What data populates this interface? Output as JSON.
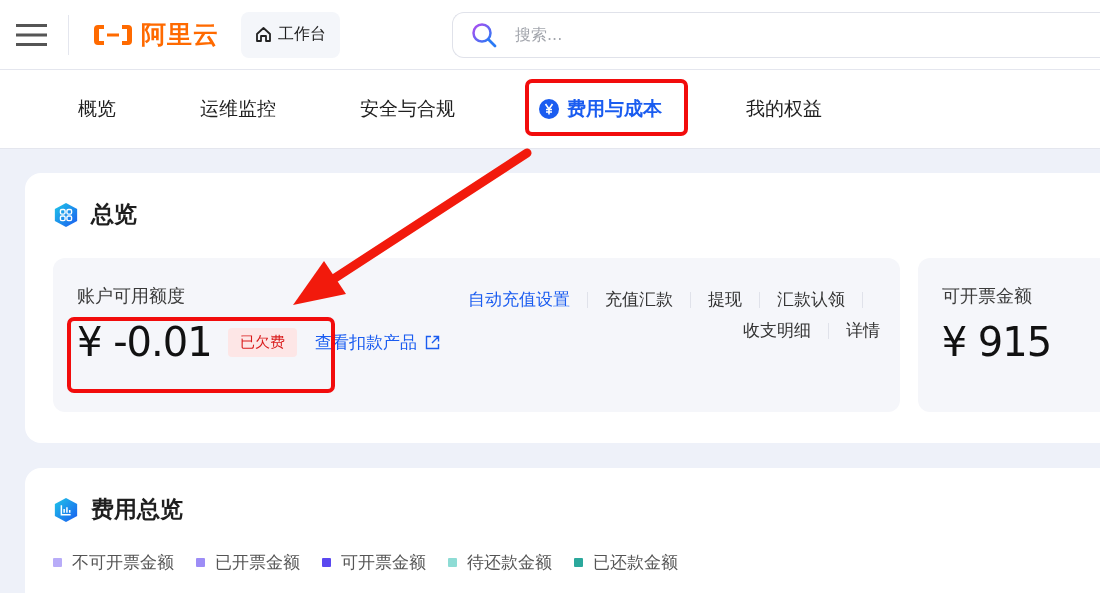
{
  "header": {
    "logo_text": "阿里云",
    "workbench": "工作台",
    "search": {
      "placeholder": "搜索..."
    }
  },
  "tabs": [
    {
      "label": "概览",
      "selected": false
    },
    {
      "label": "运维监控",
      "selected": false
    },
    {
      "label": "安全与合规",
      "selected": false
    },
    {
      "label": "费用与成本",
      "selected": true
    },
    {
      "label": "我的权益",
      "selected": false
    }
  ],
  "overview": {
    "title": "总览",
    "balance": {
      "label": "账户可用额度",
      "amount": "¥ -0.01",
      "badge": "已欠费",
      "link": "查看扣款产品"
    },
    "actions": [
      {
        "label": "自动充值设置",
        "kind": "primary"
      },
      {
        "label": "充值汇款",
        "kind": "normal"
      },
      {
        "label": "提现",
        "kind": "normal"
      },
      {
        "label": "汇款认领",
        "kind": "normal"
      },
      {
        "label": "收支明细",
        "kind": "normal"
      },
      {
        "label": "详情",
        "kind": "normal"
      }
    ],
    "invoice": {
      "label": "可开票金额",
      "amount": "¥ 915"
    }
  },
  "cost": {
    "title": "费用总览",
    "legend": [
      {
        "label": "不可开票金额",
        "color": "#b8acf8"
      },
      {
        "label": "已开票金额",
        "color": "#9d8df6"
      },
      {
        "label": "可开票金额",
        "color": "#5a48f0"
      },
      {
        "label": "待还款金额",
        "color": "#8edcd5"
      },
      {
        "label": "已还款金额",
        "color": "#2ba89c"
      }
    ]
  }
}
